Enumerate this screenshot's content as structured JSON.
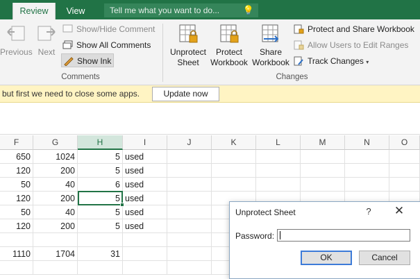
{
  "tabs": {
    "review": "Review",
    "view": "View"
  },
  "tellme": {
    "placeholder": "Tell me what you want to do...",
    "icon": "lightbulb-icon"
  },
  "ribbon": {
    "comments": {
      "previous": "Previous",
      "next": "Next",
      "show_hide": "Show/Hide Comment",
      "show_all": "Show All Comments",
      "show_ink": "Show Ink",
      "label": "Comments"
    },
    "changes": {
      "unprotect_sheet": [
        "Unprotect",
        "Sheet"
      ],
      "protect_workbook": [
        "Protect",
        "Workbook"
      ],
      "share_workbook": [
        "Share",
        "Workbook"
      ],
      "protect_share": "Protect and Share Workbook",
      "allow_users": "Allow Users to Edit Ranges",
      "track_changes": "Track Changes",
      "label": "Changes"
    }
  },
  "message": {
    "text": "but first we need to close some apps.",
    "button": "Update now"
  },
  "columns": [
    "F",
    "G",
    "H",
    "I",
    "J",
    "K",
    "L",
    "M",
    "N",
    "O"
  ],
  "selected_column": "H",
  "rows": [
    {
      "F": "650",
      "G": "1024",
      "H": "5",
      "I": "used"
    },
    {
      "F": "120",
      "G": "200",
      "H": "5",
      "I": "used"
    },
    {
      "F": "50",
      "G": "40",
      "H": "6",
      "I": "used"
    },
    {
      "F": "120",
      "G": "200",
      "H": "5",
      "I": "used"
    },
    {
      "F": "50",
      "G": "40",
      "H": "5",
      "I": "used"
    },
    {
      "F": "120",
      "G": "200",
      "H": "5",
      "I": "used"
    },
    {
      "F": "",
      "G": "",
      "H": "",
      "I": ""
    },
    {
      "F": "1110",
      "G": "1704",
      "H": "31",
      "I": ""
    }
  ],
  "dialog": {
    "title": "Unprotect Sheet",
    "help": "?",
    "close": "✕",
    "password_label": "Password:",
    "password_value": "",
    "ok": "OK",
    "cancel": "Cancel"
  },
  "colors": {
    "accent": "#217346",
    "message_bar": "#fff4c3"
  }
}
